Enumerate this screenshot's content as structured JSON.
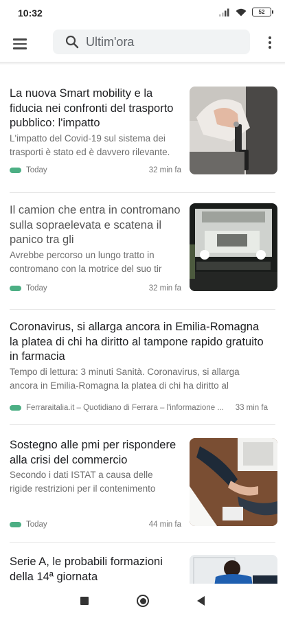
{
  "status_bar": {
    "time": "10:32",
    "battery": "52"
  },
  "search": {
    "value": "Ultim'ora"
  },
  "articles": [
    {
      "title": "La nuova Smart mobility e la fiducia nei confronti del trasporto pubblico: l'impatto",
      "snippet_1": "L'impatto del Covid-19 sul sistema dei",
      "snippet_2": "trasporti è stato ed è davvero rilevante.",
      "source": "Today",
      "time": "32 min fa"
    },
    {
      "title": "Il camion che entra in contromano sulla sopraelevata e scatena il panico tra gli",
      "snippet_1": "Avrebbe percorso un lungo tratto in",
      "snippet_2": "contromano con la motrice del suo tir",
      "source": "Today",
      "time": "32 min fa"
    },
    {
      "title": "Coronavirus, si allarga ancora in Emilia-Romagna la platea di chi ha diritto al tampone rapido gratuito in farmacia",
      "snippet_1": "Tempo di lettura: 3 minuti Sanità. Coronavirus, si allarga",
      "snippet_2": "ancora in Emilia-Romagna la platea di chi ha diritto al",
      "source": "Ferraraitalia.it – Quotidiano di Ferrara – l'informazione ...",
      "time": "33 min fa"
    },
    {
      "title": "Sostegno alle pmi per rispondere alla crisi del commercio",
      "snippet_1": "Secondo i dati ISTAT a causa delle",
      "snippet_2": "rigide restrizioni per il contenimento",
      "source": "Today",
      "time": "44 min fa"
    },
    {
      "title": "Serie A, le probabili formazioni della 14ª giornata"
    }
  ]
}
